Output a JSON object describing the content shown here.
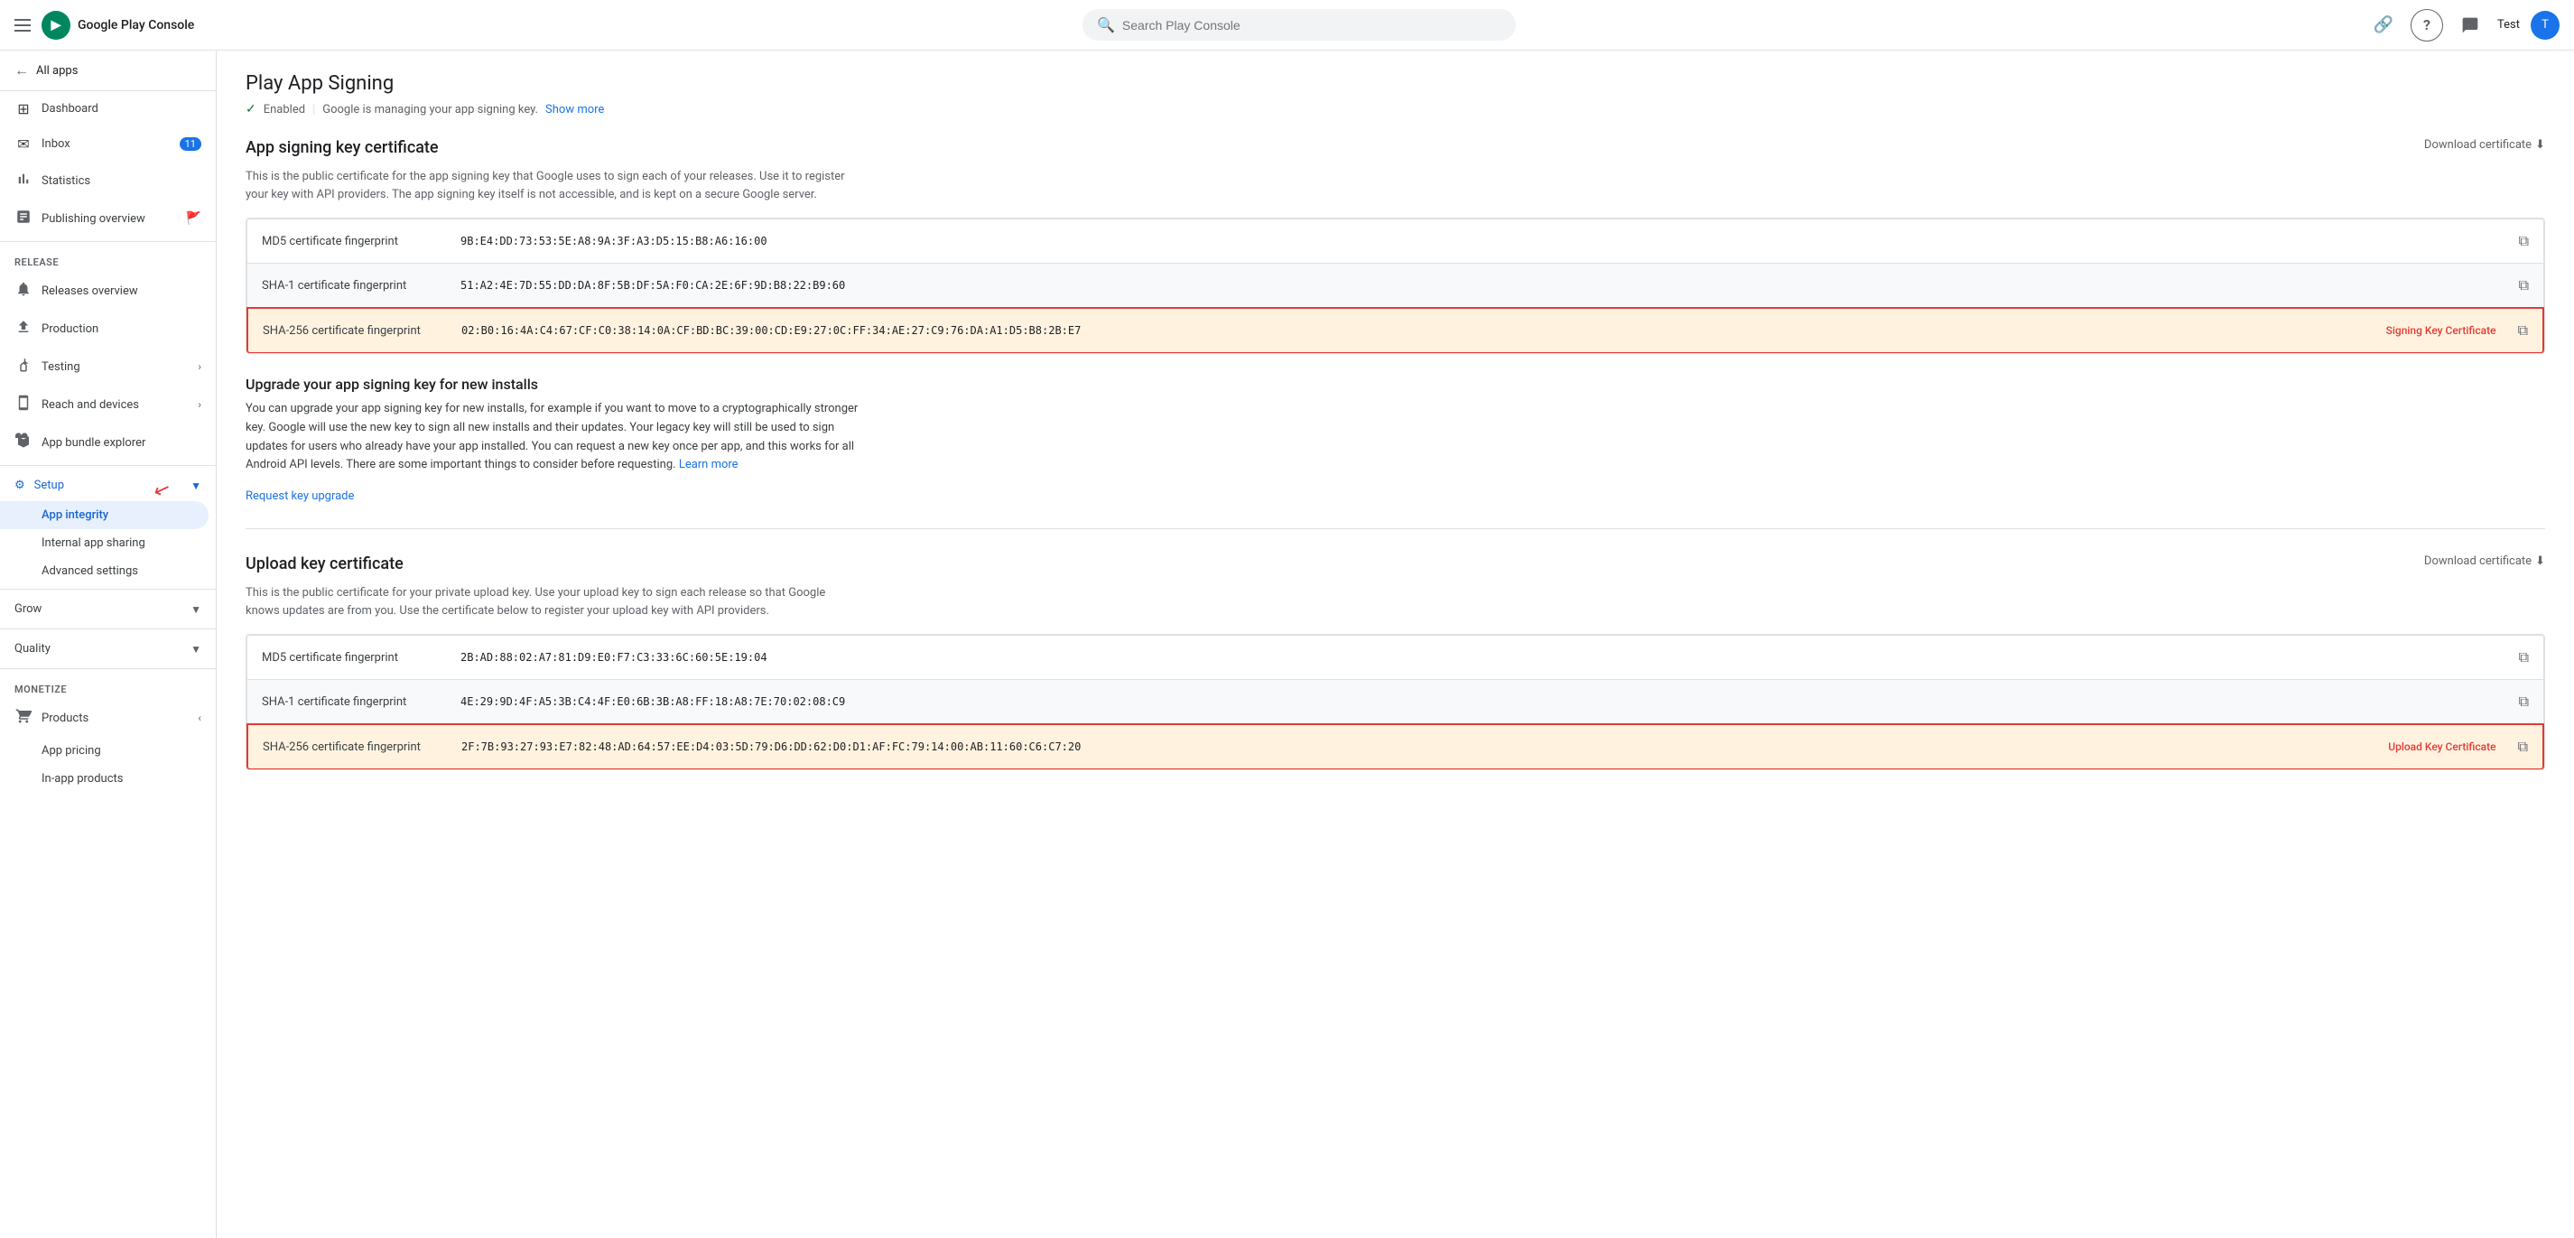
{
  "topbar": {
    "hamburger_label": "Menu",
    "brand_name": "Google Play Console",
    "brand_initial": "▶",
    "search_placeholder": "Search Play Console",
    "link_icon": "🔗",
    "help_icon": "?",
    "feedback_icon": "✉",
    "username": "Test",
    "avatar_initial": "T"
  },
  "sidebar": {
    "all_apps_label": "All apps",
    "items": [
      {
        "id": "dashboard",
        "label": "Dashboard",
        "icon": "⊞"
      },
      {
        "id": "inbox",
        "label": "Inbox",
        "icon": "✉",
        "badge": "11"
      },
      {
        "id": "statistics",
        "label": "Statistics",
        "icon": "📊"
      },
      {
        "id": "publishing-overview",
        "label": "Publishing overview",
        "icon": "📋"
      }
    ],
    "release_section": "Release",
    "release_items": [
      {
        "id": "releases-overview",
        "label": "Releases overview",
        "icon": "🔔"
      },
      {
        "id": "production",
        "label": "Production",
        "icon": "⬆"
      },
      {
        "id": "testing",
        "label": "Testing",
        "icon": "🔬"
      },
      {
        "id": "reach-and-devices",
        "label": "Reach and devices",
        "icon": "📱"
      },
      {
        "id": "app-bundle-explorer",
        "label": "App bundle explorer",
        "icon": "📦"
      }
    ],
    "setup_label": "Setup",
    "setup_icon": "⚙",
    "setup_sub": [
      {
        "id": "app-integrity",
        "label": "App integrity",
        "active": true
      },
      {
        "id": "internal-app-sharing",
        "label": "Internal app sharing"
      },
      {
        "id": "advanced-settings",
        "label": "Advanced settings"
      }
    ],
    "grow_label": "Grow",
    "quality_label": "Quality",
    "monetize_label": "Monetize",
    "products_label": "Products",
    "products_icon": "🛒",
    "products_sub": [
      {
        "id": "app-pricing",
        "label": "App pricing"
      },
      {
        "id": "in-app-products",
        "label": "In-app products"
      }
    ]
  },
  "main": {
    "page_title": "Play App Signing",
    "status_check": "✓",
    "status_enabled": "Enabled",
    "status_google": "Google is managing your app signing key.",
    "show_more": "Show more",
    "app_signing_section": {
      "title": "App signing key certificate",
      "download_label": "Download certificate",
      "description": "This is the public certificate for the app signing key that Google uses to sign each of your releases. Use it to register your key with API providers. The app signing key itself is not accessible, and is kept on a secure Google server.",
      "rows": [
        {
          "label": "MD5 certificate fingerprint",
          "value": "9B:E4:DD:73:53:5E:A8:9A:3F:A3:D5:15:B8:A6:16:00",
          "highlighted": false,
          "tag": ""
        },
        {
          "label": "SHA-1 certificate fingerprint",
          "value": "51:A2:4E:7D:55:DD:DA:8F:5B:DF:5A:F0:CA:2E:6F:9D:B8:22:B9:60",
          "highlighted": false,
          "tag": ""
        },
        {
          "label": "SHA-256 certificate fingerprint",
          "value": "02:B0:16:4A:C4:67:CF:C0:38:14:0A:CF:BD:BC:39:00:CD:E9:27:0C:FF:34:AE:27:C9:76:DA:A1:D5:B8:2B:E7",
          "highlighted": true,
          "tag": "Signing Key Certificate"
        }
      ]
    },
    "upgrade_section": {
      "title": "Upgrade your app signing key for new installs",
      "description": "You can upgrade your app signing key for new installs, for example if you want to move to a cryptographically stronger key. Google will use the new key to sign all new installs and their updates. Your legacy key will still be used to sign updates for users who already have your app installed. You can request a new key once per app, and this works for all Android API levels. There are some important things to consider before requesting.",
      "learn_more": "Learn more",
      "request_link": "Request key upgrade"
    },
    "upload_section": {
      "title": "Upload key certificate",
      "download_label": "Download certificate",
      "description": "This is the public certificate for your private upload key. Use your upload key to sign each release so that Google knows updates are from you. Use the certificate below to register your upload key with API providers.",
      "rows": [
        {
          "label": "MD5 certificate fingerprint",
          "value": "2B:AD:88:02:A7:81:D9:E0:F7:C3:33:6C:60:5E:19:04",
          "highlighted": false,
          "tag": ""
        },
        {
          "label": "SHA-1 certificate fingerprint",
          "value": "4E:29:9D:4F:A5:3B:C4:4F:E0:6B:3B:A8:FF:18:A8:7E:70:02:08:C9",
          "highlighted": false,
          "tag": ""
        },
        {
          "label": "SHA-256 certificate fingerprint",
          "value": "2F:7B:93:27:93:E7:82:48:AD:64:57:EE:D4:03:5D:79:D6:DD:62:D0:D1:AF:FC:79:14:00:AB:11:60:C6:C7:20",
          "highlighted": true,
          "tag": "Upload Key Certificate"
        }
      ]
    }
  }
}
